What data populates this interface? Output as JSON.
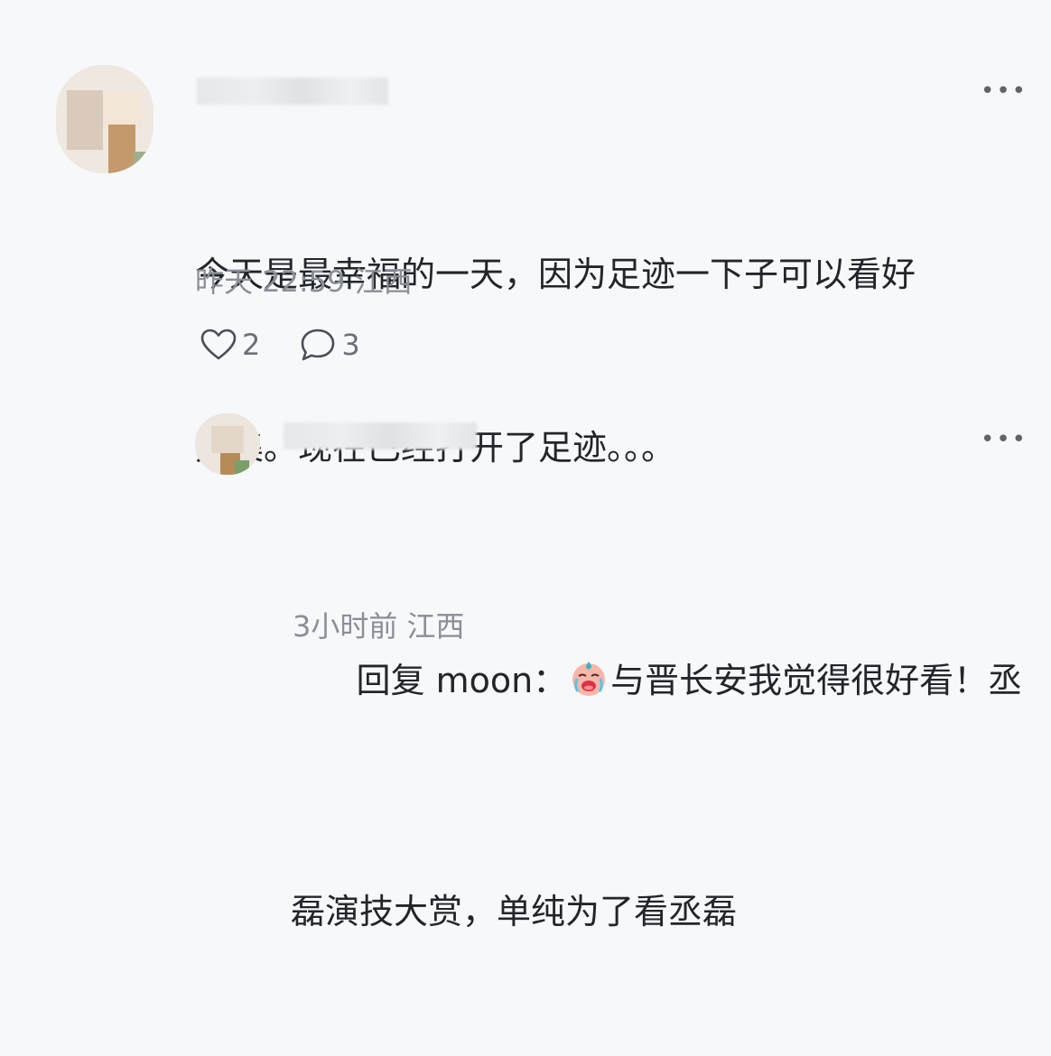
{
  "comments": [
    {
      "time": "昨天 22:59",
      "location": "江西",
      "text_line1": "今天是最幸福的一天，因为足迹一下子可以看好",
      "text_line2": "几集。现在已经打开了足迹。。。",
      "likes": "2",
      "replies": "3"
    }
  ],
  "reply": {
    "prefix": "回复 moon：",
    "text_line1_after_emoji": "与晋长安我觉得很好看！丞",
    "text_line2": "磊演技大赏，单纯为了看丞磊",
    "time": "3小时前",
    "location": "江西"
  },
  "icons": {
    "more": "more-dots-icon",
    "like": "heart-icon",
    "reply": "comment-bubble-icon",
    "emoji": "crying-face-emoji"
  }
}
